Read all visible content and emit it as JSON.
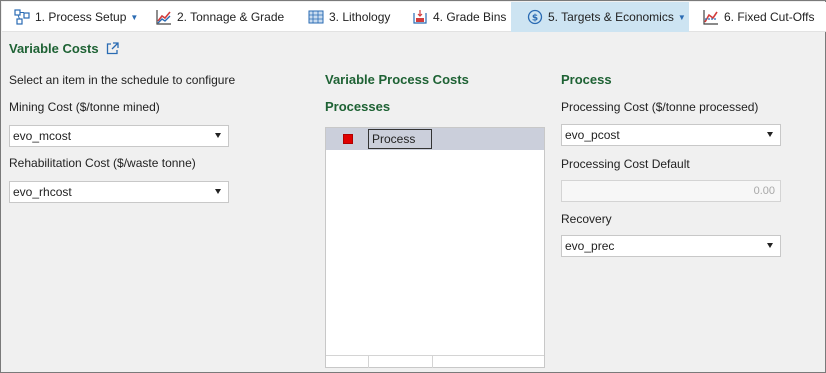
{
  "tabs": [
    {
      "label": "1. Process Setup",
      "icon": "process-setup-icon",
      "dropdown": true
    },
    {
      "label": "2. Tonnage & Grade",
      "icon": "chart-icon",
      "dropdown": false
    },
    {
      "label": "3. Lithology",
      "icon": "lithology-icon",
      "dropdown": false
    },
    {
      "label": "4. Grade Bins",
      "icon": "grade-bins-icon",
      "dropdown": false
    },
    {
      "label": "5. Targets & Economics",
      "icon": "dollar-icon",
      "dropdown": true,
      "active": true
    },
    {
      "label": "6. Fixed Cut-Offs",
      "icon": "cutoff-chart-icon",
      "dropdown": false
    }
  ],
  "section_title": "Variable Costs",
  "left": {
    "instruction": "Select an item in the schedule to configure",
    "mining_cost_label": "Mining Cost ($/tonne mined)",
    "mining_cost_value": "evo_mcost",
    "rehab_cost_label": "Rehabilitation Cost ($/waste tonne)",
    "rehab_cost_value": "evo_rhcost"
  },
  "middle": {
    "heading": "Variable Process Costs",
    "subheading": "Processes",
    "rows": [
      {
        "name": "Process",
        "color": "#e00000"
      }
    ]
  },
  "right": {
    "heading": "Process",
    "processing_cost_label": "Processing Cost ($/tonne processed)",
    "processing_cost_value": "evo_pcost",
    "processing_default_label": "Processing Cost Default",
    "processing_default_value": "0.00",
    "recovery_label": "Recovery",
    "recovery_value": "evo_prec"
  },
  "colors": {
    "heading_green": "#1e6234",
    "active_tab": "#cde4f2",
    "accent_blue": "#2a6bb3"
  }
}
